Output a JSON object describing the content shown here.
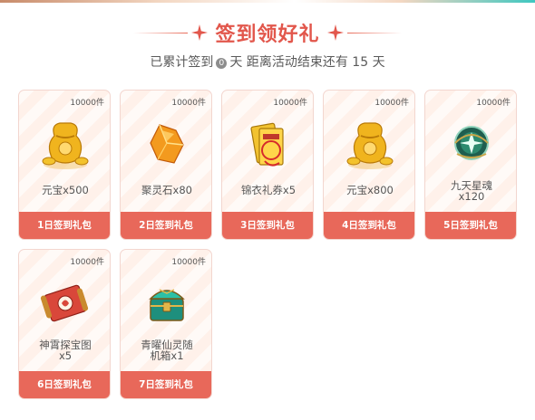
{
  "header": {
    "title": "签到领好礼",
    "subtitle_prefix": "已累计签到",
    "signed_days": "0",
    "subtitle_suffix": "天  距离活动结束还有 15 天"
  },
  "rewards": [
    {
      "qty": "10000件",
      "name": "元宝x500",
      "day_label": "1日签到礼包",
      "icon": "gold-ingot-bag-icon"
    },
    {
      "qty": "10000件",
      "name": "聚灵石x80",
      "day_label": "2日签到礼包",
      "icon": "spirit-stone-icon"
    },
    {
      "qty": "10000件",
      "name": "锦衣礼券x5",
      "day_label": "3日签到礼包",
      "icon": "gift-voucher-icon"
    },
    {
      "qty": "10000件",
      "name": "元宝x800",
      "day_label": "4日签到礼包",
      "icon": "gold-ingot-bag-icon"
    },
    {
      "qty": "10000件",
      "name_line1": "九天星魂",
      "name_line2": "x120",
      "day_label": "5日签到礼包",
      "icon": "star-soul-orb-icon"
    },
    {
      "qty": "10000件",
      "name_line1": "神霄探宝图",
      "name_line2": "x5",
      "day_label": "6日签到礼包",
      "icon": "treasure-map-scroll-icon"
    },
    {
      "qty": "10000件",
      "name_line1": "青曜仙灵随",
      "name_line2": "机箱x1",
      "day_label": "7日签到礼包",
      "icon": "jade-treasure-chest-icon"
    }
  ],
  "colors": {
    "accent": "#e2574c",
    "footer": "#e8685a",
    "border": "#f3d6cf"
  }
}
